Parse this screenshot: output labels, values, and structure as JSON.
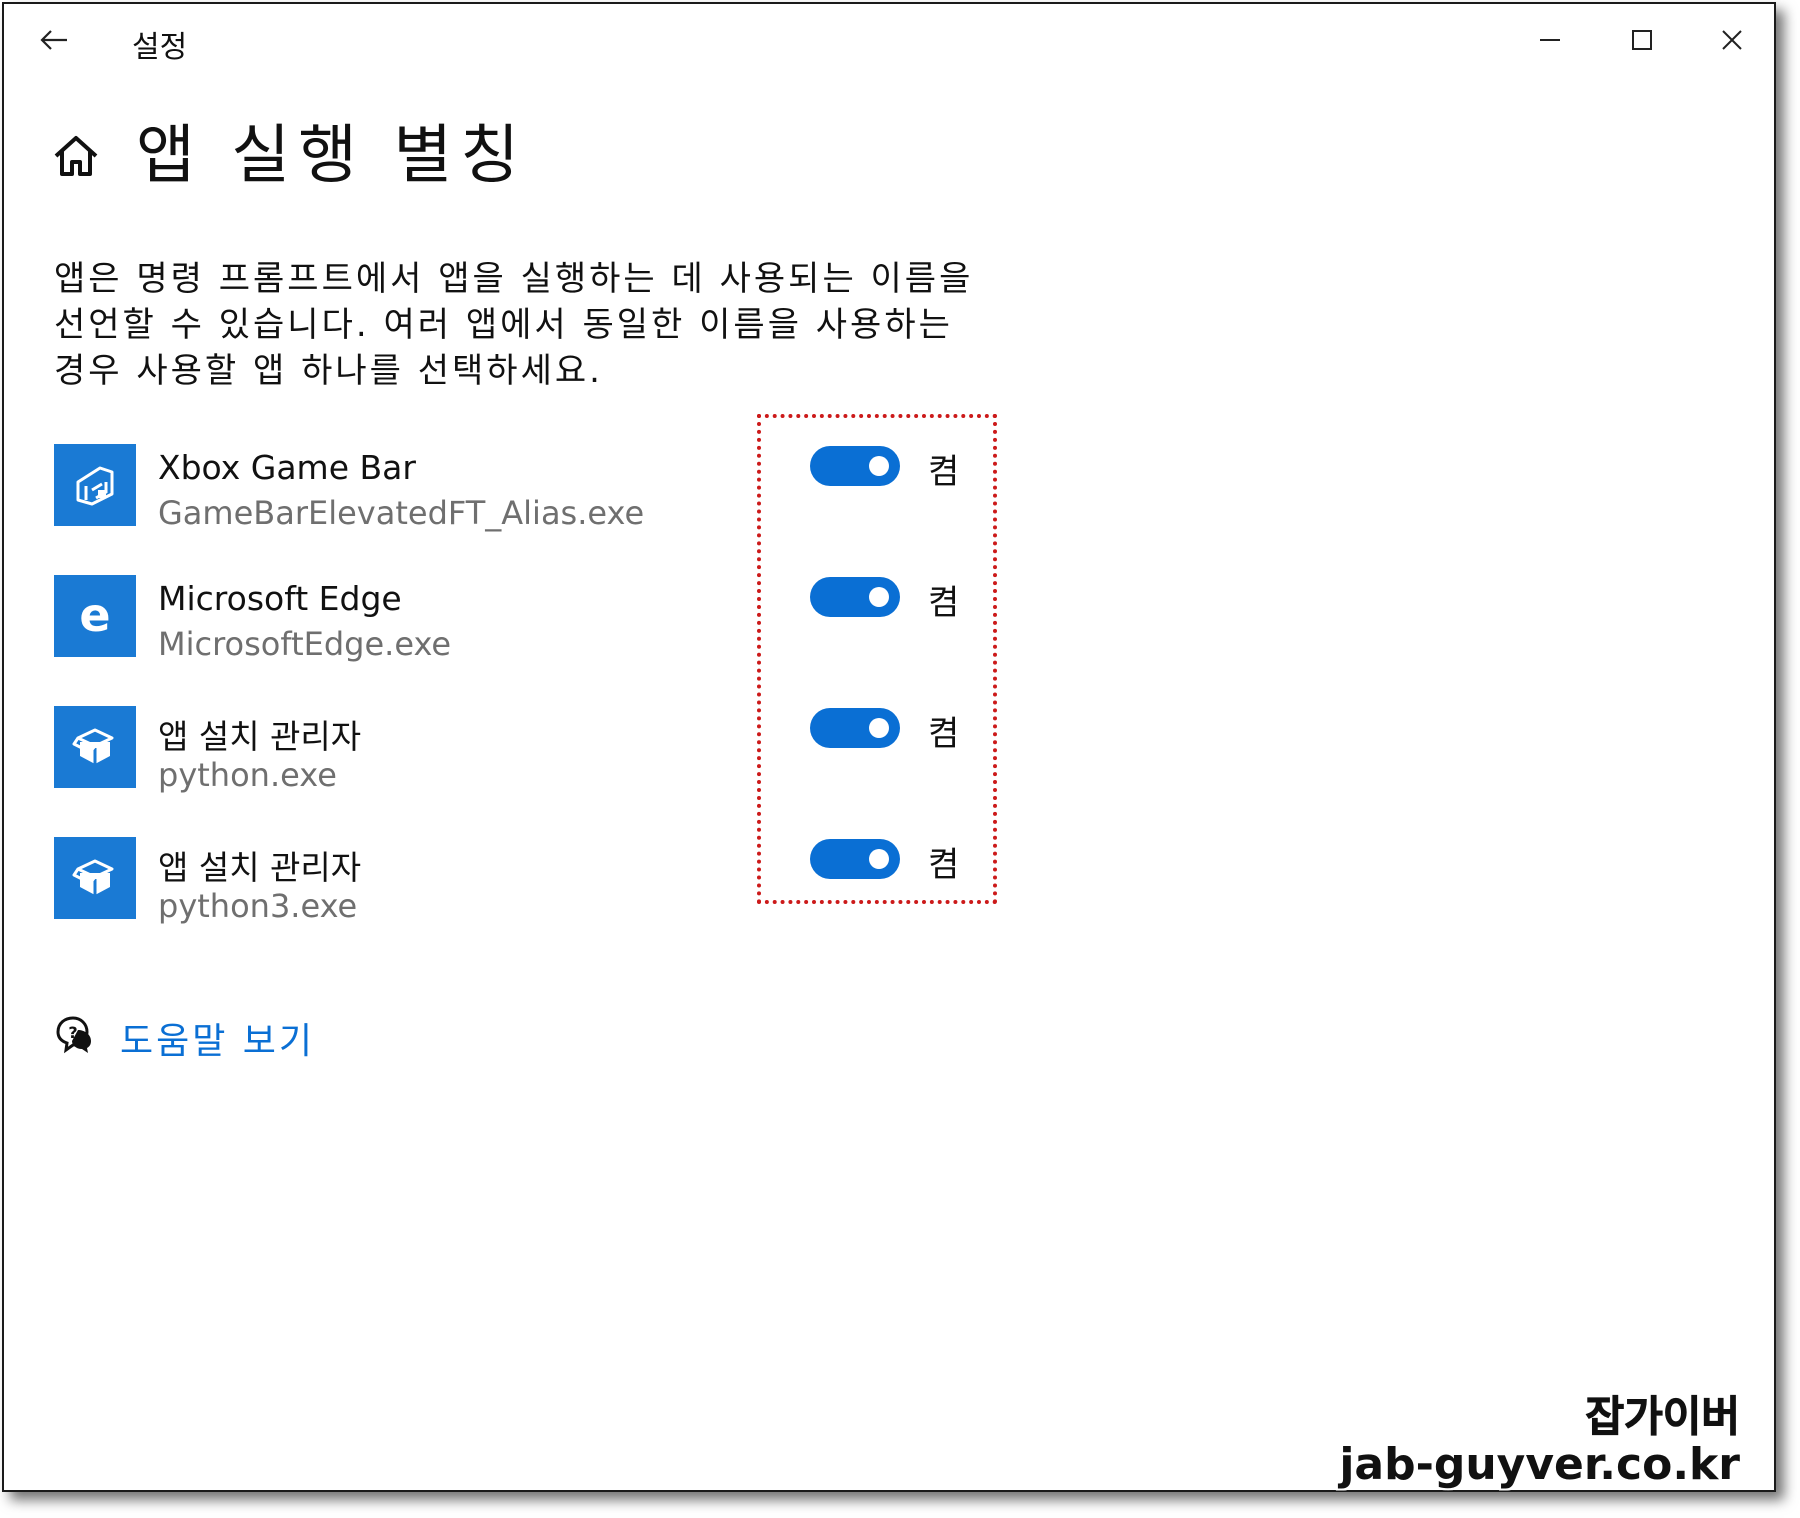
{
  "window": {
    "title": "설정",
    "back_icon": "back-arrow-icon",
    "minimize_icon": "minimize-icon",
    "maximize_icon": "maximize-icon",
    "close_icon": "close-icon"
  },
  "page": {
    "home_icon": "home-icon",
    "title": "앱 실행 별칭",
    "description": "앱은 명령 프롬프트에서 앱을 실행하는 데 사용되는 이름을 선언할 수 있습니다. 여러 앱에서 동일한 이름을 사용하는 경우 사용할 앱 하나를 선택하세요."
  },
  "aliases": [
    {
      "name": "Xbox Game Bar",
      "exe": "GameBarElevatedFT_Alias.exe",
      "icon": "xbox-game-bar-icon",
      "enabled": true,
      "state_label": "켬"
    },
    {
      "name": "Microsoft Edge",
      "exe": "MicrosoftEdge.exe",
      "icon": "edge-icon",
      "enabled": true,
      "state_label": "켬"
    },
    {
      "name": "앱 설치 관리자",
      "exe": "python.exe",
      "icon": "app-installer-icon",
      "enabled": true,
      "state_label": "켬"
    },
    {
      "name": "앱 설치 관리자",
      "exe": "python3.exe",
      "icon": "app-installer-icon",
      "enabled": true,
      "state_label": "켬"
    }
  ],
  "help": {
    "icon": "help-chat-icon",
    "label": "도움말 보기"
  },
  "watermark": {
    "line1": "잡가이버",
    "line2": "jab-guyver.co.kr"
  },
  "colors": {
    "accent": "#0a6fd4",
    "app_tile": "#1a7ad4",
    "highlight": "#cc1a1a",
    "secondary_text": "#6f6f6f"
  }
}
